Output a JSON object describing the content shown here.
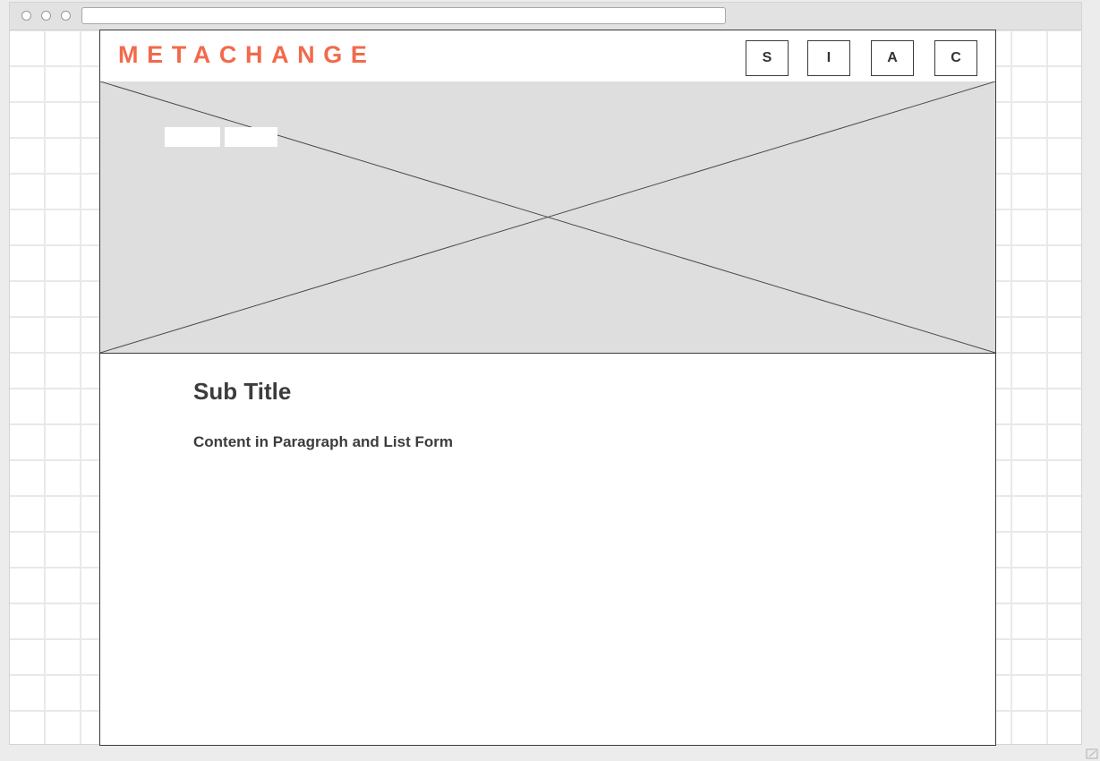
{
  "browser": {
    "address": ""
  },
  "header": {
    "logo": "METACHANGE",
    "nav": [
      {
        "label": "S"
      },
      {
        "label": "I"
      },
      {
        "label": "A"
      },
      {
        "label": "C"
      }
    ]
  },
  "hero": {
    "image_placeholder": "image-placeholder"
  },
  "main": {
    "subtitle": "Sub Title",
    "content": "Content in Paragraph and List Form"
  },
  "colors": {
    "logo": "#f26a4b",
    "hero_fill": "#dedede",
    "text": "#3c3c3c",
    "border": "#3a3a3a"
  }
}
